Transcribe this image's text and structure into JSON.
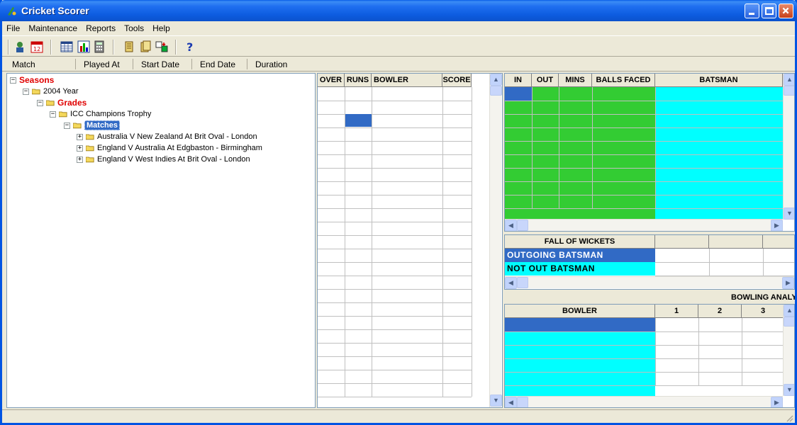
{
  "window": {
    "title": "Cricket Scorer"
  },
  "menu": [
    "File",
    "Maintenance",
    "Reports",
    "Tools",
    "Help"
  ],
  "toolbar": {
    "icons": [
      "user-icon",
      "calendar-icon",
      "table-icon",
      "chart-icon",
      "calculator-icon",
      "scroll-icon",
      "document-icon",
      "transfer-icon",
      "help-icon"
    ]
  },
  "columns": {
    "match": "Match",
    "played_at": "Played At",
    "start_date": "Start Date",
    "end_date": "End Date",
    "duration": "Duration"
  },
  "tree": {
    "root": "Seasons",
    "year": "2004 Year",
    "grades": "Grades",
    "trophy": "ICC Champions Trophy",
    "matches_label": "Matches",
    "matches": [
      "Australia V New Zealand At Brit Oval - London",
      "England V Australia At Edgbaston - Birmingham",
      "England V West Indies At Brit Oval - London"
    ]
  },
  "over_grid": {
    "headers": [
      "OVER",
      "RUNS",
      "BOWLER",
      "SCORE"
    ]
  },
  "batting_grid": {
    "headers": [
      "IN",
      "OUT",
      "MINS",
      "BALLS FACED",
      "BATSMAN"
    ]
  },
  "fall_of_wickets": {
    "header": "FALL OF WICKETS",
    "row1": "OUTGOING BATSMAN",
    "row2": "NOT OUT BATSMAN"
  },
  "bowling": {
    "title": "BOWLING ANALYSIS",
    "header": "BOWLER",
    "overs": [
      "1",
      "2",
      "3"
    ]
  },
  "colors": {
    "green": "#33cc33",
    "cyan": "#00ffff",
    "selection": "#316ac5",
    "accent_red": "#e00000"
  }
}
